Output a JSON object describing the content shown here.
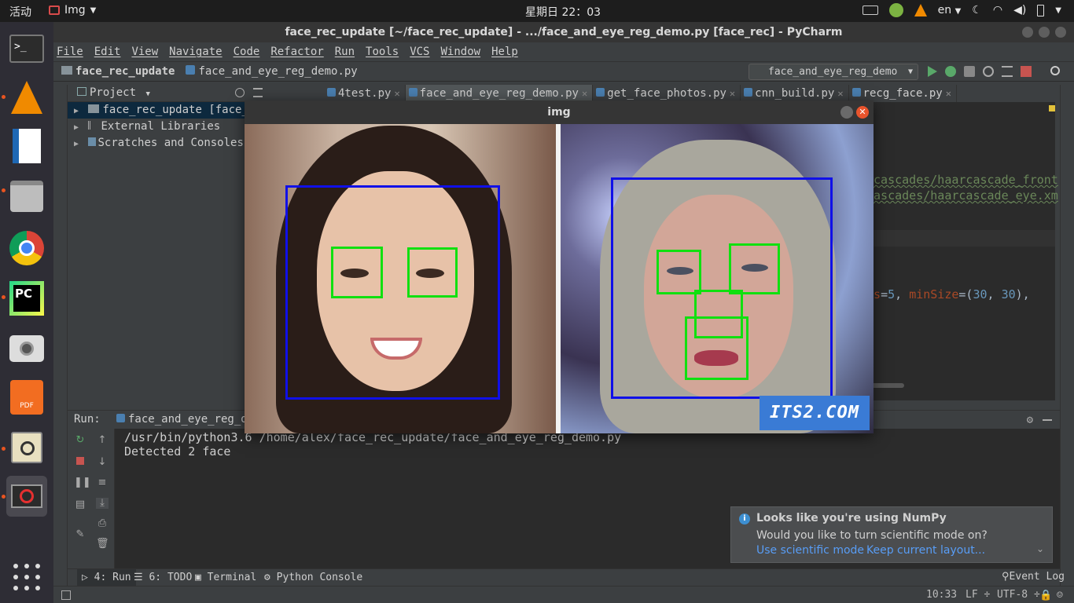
{
  "topbar": {
    "activities": "活动",
    "app_name": "Img",
    "clock": "星期日 22：03",
    "lang": "en"
  },
  "pycharm": {
    "title": "face_rec_update [~/face_rec_update] - .../face_and_eye_reg_demo.py [face_rec] - PyCharm",
    "menu": [
      "File",
      "Edit",
      "View",
      "Navigate",
      "Code",
      "Refactor",
      "Run",
      "Tools",
      "VCS",
      "Window",
      "Help"
    ],
    "breadcrumb": {
      "project": "face_rec_update",
      "file": "face_and_eye_reg_demo.py"
    },
    "run_config": "face_and_eye_reg_demo",
    "project_panel": {
      "title": "Project",
      "items": [
        {
          "label": "face_rec_update [face_r",
          "icon": "folder-icon"
        },
        {
          "label": "External Libraries",
          "icon": "library-icon"
        },
        {
          "label": "Scratches and Consoles",
          "icon": "scratch-icon"
        }
      ]
    },
    "tabs": [
      {
        "label": "4test.py",
        "selected": false
      },
      {
        "label": "face_and_eye_reg_demo.py",
        "selected": true
      },
      {
        "label": "get_face_photos.py",
        "selected": false
      },
      {
        "label": "cnn_build.py",
        "selected": false
      },
      {
        "label": "recg_face.py",
        "selected": false
      }
    ],
    "editor": {
      "line1": "rcascades/haarcascade_front",
      "line2": "cascades/haarcascade_eye.xm",
      "line3_kw1": "rs",
      "line3_eq1": "=",
      "line3_num1": "5",
      "line3_mid": ", ",
      "line3_kw2": "minSize",
      "line3_eq2": "=(",
      "line3_num2": "30",
      "line3_sep": ", ",
      "line3_num3": "30",
      "line3_end": "),"
    },
    "run_panel": {
      "label": "Run:",
      "tab": "face_and_eye_reg_d",
      "output_line1": "/usr/bin/python3.6 /home/alex/face_rec_update/face_and_eye_reg_demo.py",
      "output_line2": "Detected  2  face"
    },
    "tool_tabs": [
      {
        "label": "4: Run"
      },
      {
        "label": "6: TODO"
      },
      {
        "label": "Terminal"
      },
      {
        "label": "Python Console"
      }
    ],
    "event_log": "Event Log",
    "status": {
      "position": "10:33",
      "line_sep": "LF",
      "encoding": "UTF-8"
    },
    "notification": {
      "title": "Looks like you're using NumPy",
      "body": "Would you like to turn scientific mode on?",
      "link1": "Use scientific mode",
      "link2": "Keep current layout..."
    }
  },
  "img_window": {
    "title": "img",
    "watermark": "ITS2.COM"
  }
}
